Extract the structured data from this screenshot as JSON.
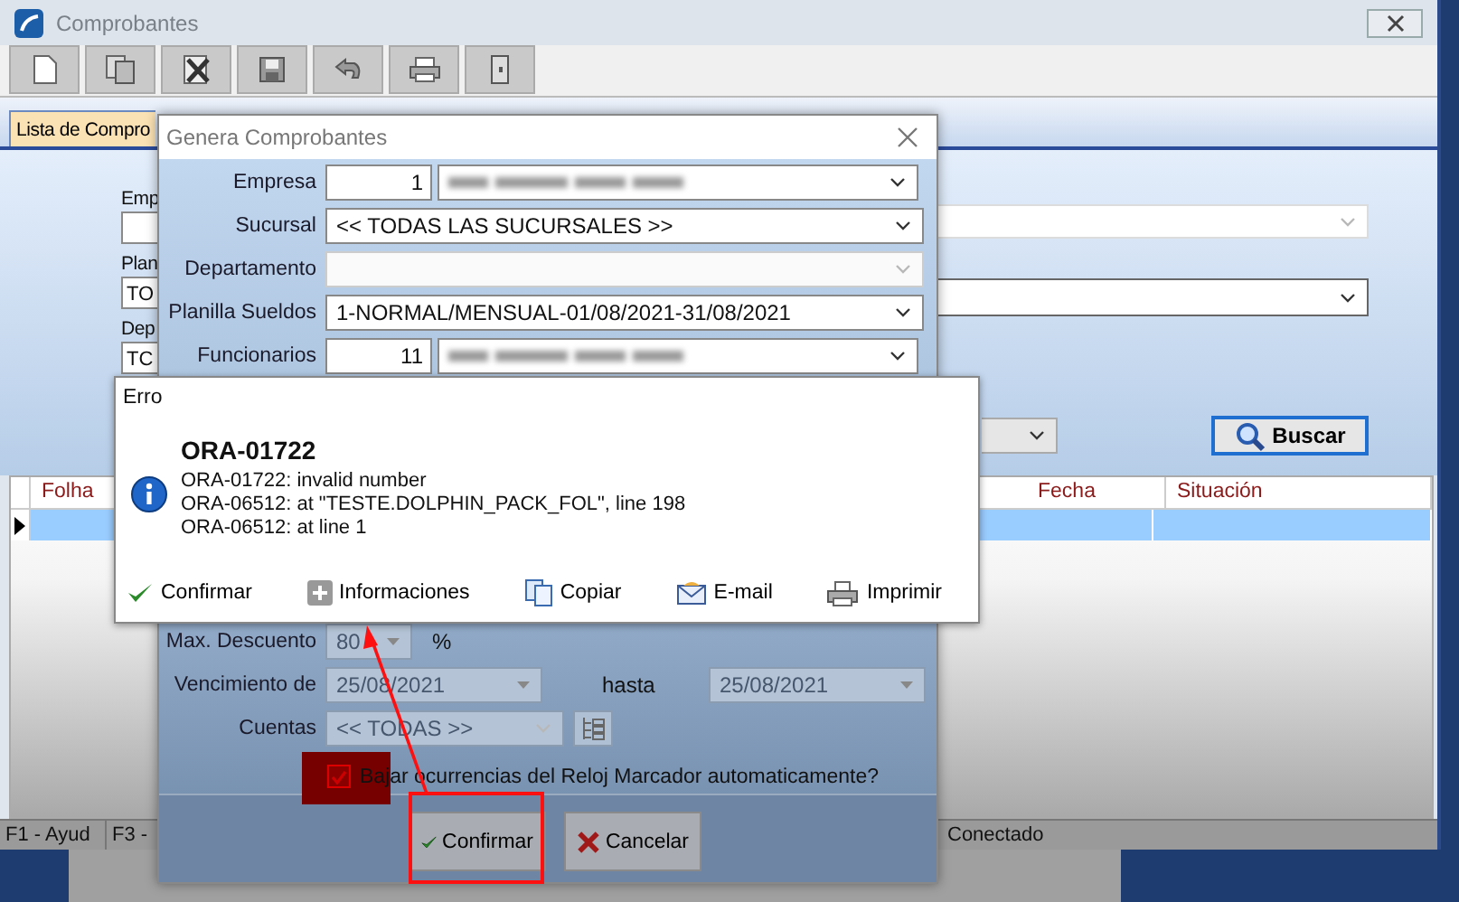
{
  "main_window": {
    "title": "Comprobantes",
    "tabs": [
      {
        "label": "Lista de Compro",
        "selected": true
      }
    ],
    "filters": [
      {
        "label": "Emp"
      },
      {
        "label": "Plan",
        "value": "TO"
      },
      {
        "label": "Dep",
        "value": "TC"
      }
    ],
    "right_filters": [
      {
        "disabled": true
      },
      {
        "disabled": false
      }
    ],
    "type_select": {
      "disabled": true
    },
    "search_button": "Buscar",
    "grid": {
      "columns": [
        {
          "label": "Folha"
        },
        {
          "label": "Fecha"
        },
        {
          "label": "Situación"
        }
      ],
      "rows": [
        {
          "selected": true
        }
      ]
    },
    "status_bar": [
      "F1 - Ayud",
      "F3 -",
      "Conectado"
    ]
  },
  "generate_dialog": {
    "title": "Genera Comprobantes",
    "fields": [
      {
        "label": "Empresa",
        "kind": "code_name",
        "code": "1"
      },
      {
        "label": "Sucursal",
        "kind": "select",
        "value": "<< TODAS LAS SUCURSALES >>",
        "disabled": false
      },
      {
        "label": "Departamento",
        "kind": "select",
        "disabled": true
      },
      {
        "label": "Planilla Sueldos",
        "kind": "select",
        "value": "1-NORMAL/MENSUAL-01/08/2021-31/08/2021",
        "disabled": false
      },
      {
        "label": "Funcionarios",
        "kind": "code_name",
        "code": "11"
      }
    ],
    "max_discount": {
      "label": "Max. Descuento",
      "value": "80",
      "unit": "%",
      "disabled": true
    },
    "due_from": {
      "label": "Vencimiento de",
      "value": "25/08/2021",
      "disabled": true
    },
    "due_to": {
      "label": "hasta",
      "value": "25/08/2021",
      "disabled": true
    },
    "accounts": {
      "label": "Cuentas",
      "value": "<< TODAS >>",
      "disabled": true
    },
    "checkbox": {
      "label": "Bajar ocurrencias del Reloj Marcador automaticamente?",
      "checked": true
    },
    "buttons": [
      {
        "label": "Confirmar",
        "kind": "confirm"
      },
      {
        "label": "Cancelar",
        "kind": "cancel"
      }
    ]
  },
  "error_dialog": {
    "title": "Erro",
    "heading": "ORA-01722",
    "lines": [
      "ORA-01722: invalid number",
      "ORA-06512: at \"TESTE.DOLPHIN_PACK_FOL\", line 198",
      "ORA-06512: at line 1"
    ],
    "buttons": [
      {
        "label": "Confirmar",
        "kind": "confirm"
      },
      {
        "label": "Informaciones",
        "kind": "info"
      },
      {
        "label": "Copiar",
        "kind": "copy"
      },
      {
        "label": "E-mail",
        "kind": "email"
      },
      {
        "label": "Imprimir",
        "kind": "print"
      }
    ]
  }
}
